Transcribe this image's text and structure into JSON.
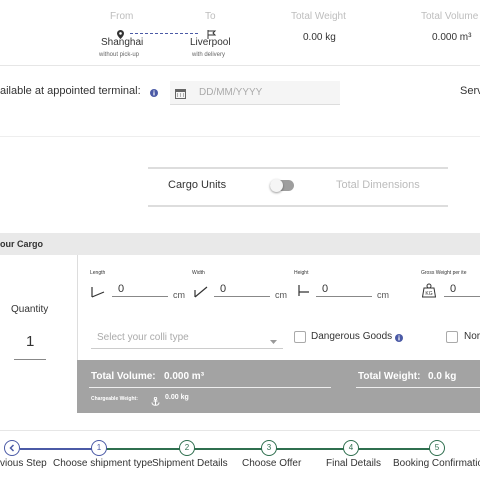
{
  "header": {
    "from_label": "From",
    "to_label": "To",
    "total_weight_label": "Total Weight",
    "total_volume_label": "Total Volume",
    "from_city": "Shanghai",
    "from_sub": "without pick-up",
    "to_city": "Liverpool",
    "to_sub": "with delivery",
    "total_weight_value": "0.00 kg",
    "total_volume_value": "0.000 m³"
  },
  "availability": {
    "label": "ailable at appointed terminal:",
    "date_placeholder": "DD/MM/YYYY",
    "right_label": "Serv"
  },
  "units": {
    "cargo_units_label": "Cargo Units",
    "total_dimensions_label": "Total Dimensions",
    "toggle_on": false
  },
  "cargo": {
    "section_title": "our Cargo",
    "quantity_label": "Quantity",
    "quantity_value": "1",
    "length_label": "Length",
    "width_label": "Width",
    "height_label": "Height",
    "gross_label": "Gross Weight per ite",
    "length_value": "0",
    "width_value": "0",
    "height_value": "0",
    "gross_value": "0",
    "unit_cm": "cm",
    "weight_icon_label": "KG",
    "colli_placeholder": "Select your colli type",
    "dangerous_goods_label": "Dangerous Goods",
    "non_label": "Nor",
    "total_volume_label": "Total Volume:",
    "total_volume_value": "0.000 m³",
    "total_weight_label": "Total Weight:",
    "total_weight_value": "0.0 kg",
    "chargeable_label": "Chargeable Weight:",
    "chargeable_value": "0.00 kg"
  },
  "steps": {
    "previous_label": "vious Step",
    "items": [
      {
        "num": "1",
        "label": "Choose shipment type"
      },
      {
        "num": "2",
        "label": "Shipment Details"
      },
      {
        "num": "3",
        "label": "Choose Offer"
      },
      {
        "num": "4",
        "label": "Final Details"
      },
      {
        "num": "5",
        "label": "Booking Confirmation"
      }
    ]
  },
  "colors": {
    "primary": "#4b5aa6",
    "step_green": "#2f6f4f",
    "totals_bg": "#a3a3a3",
    "section_bar": "#e9e9e9"
  }
}
